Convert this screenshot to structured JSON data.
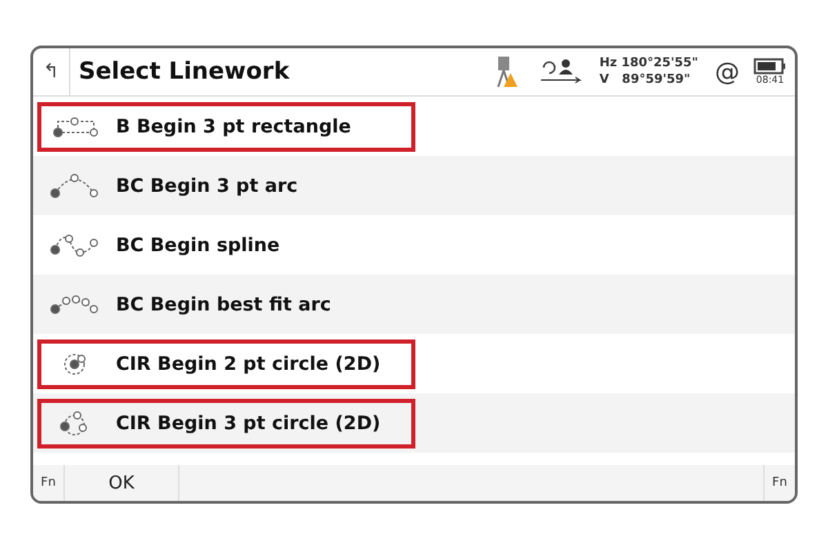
{
  "header": {
    "back": "↰",
    "title": "Select Linework",
    "hz": "Hz 180°25'55\"",
    "v": "V   89°59'59\"",
    "at": "@",
    "time": "08:41"
  },
  "items": [
    {
      "label": "B Begin 3 pt rectangle",
      "kind": "rectangle",
      "highlighted": true
    },
    {
      "label": "BC Begin 3 pt arc",
      "kind": "arc",
      "highlighted": false
    },
    {
      "label": "BC Begin spline",
      "kind": "spline",
      "highlighted": false
    },
    {
      "label": "BC Begin best fit arc",
      "kind": "bestfit",
      "highlighted": false
    },
    {
      "label": "CIR Begin 2 pt circle (2D)",
      "kind": "circle2",
      "highlighted": true
    },
    {
      "label": "CIR Begin 3 pt circle (2D)",
      "kind": "circle3",
      "highlighted": true
    }
  ],
  "footer": {
    "fn_left": "Fn",
    "ok": "OK",
    "fn_right": "Fn"
  }
}
